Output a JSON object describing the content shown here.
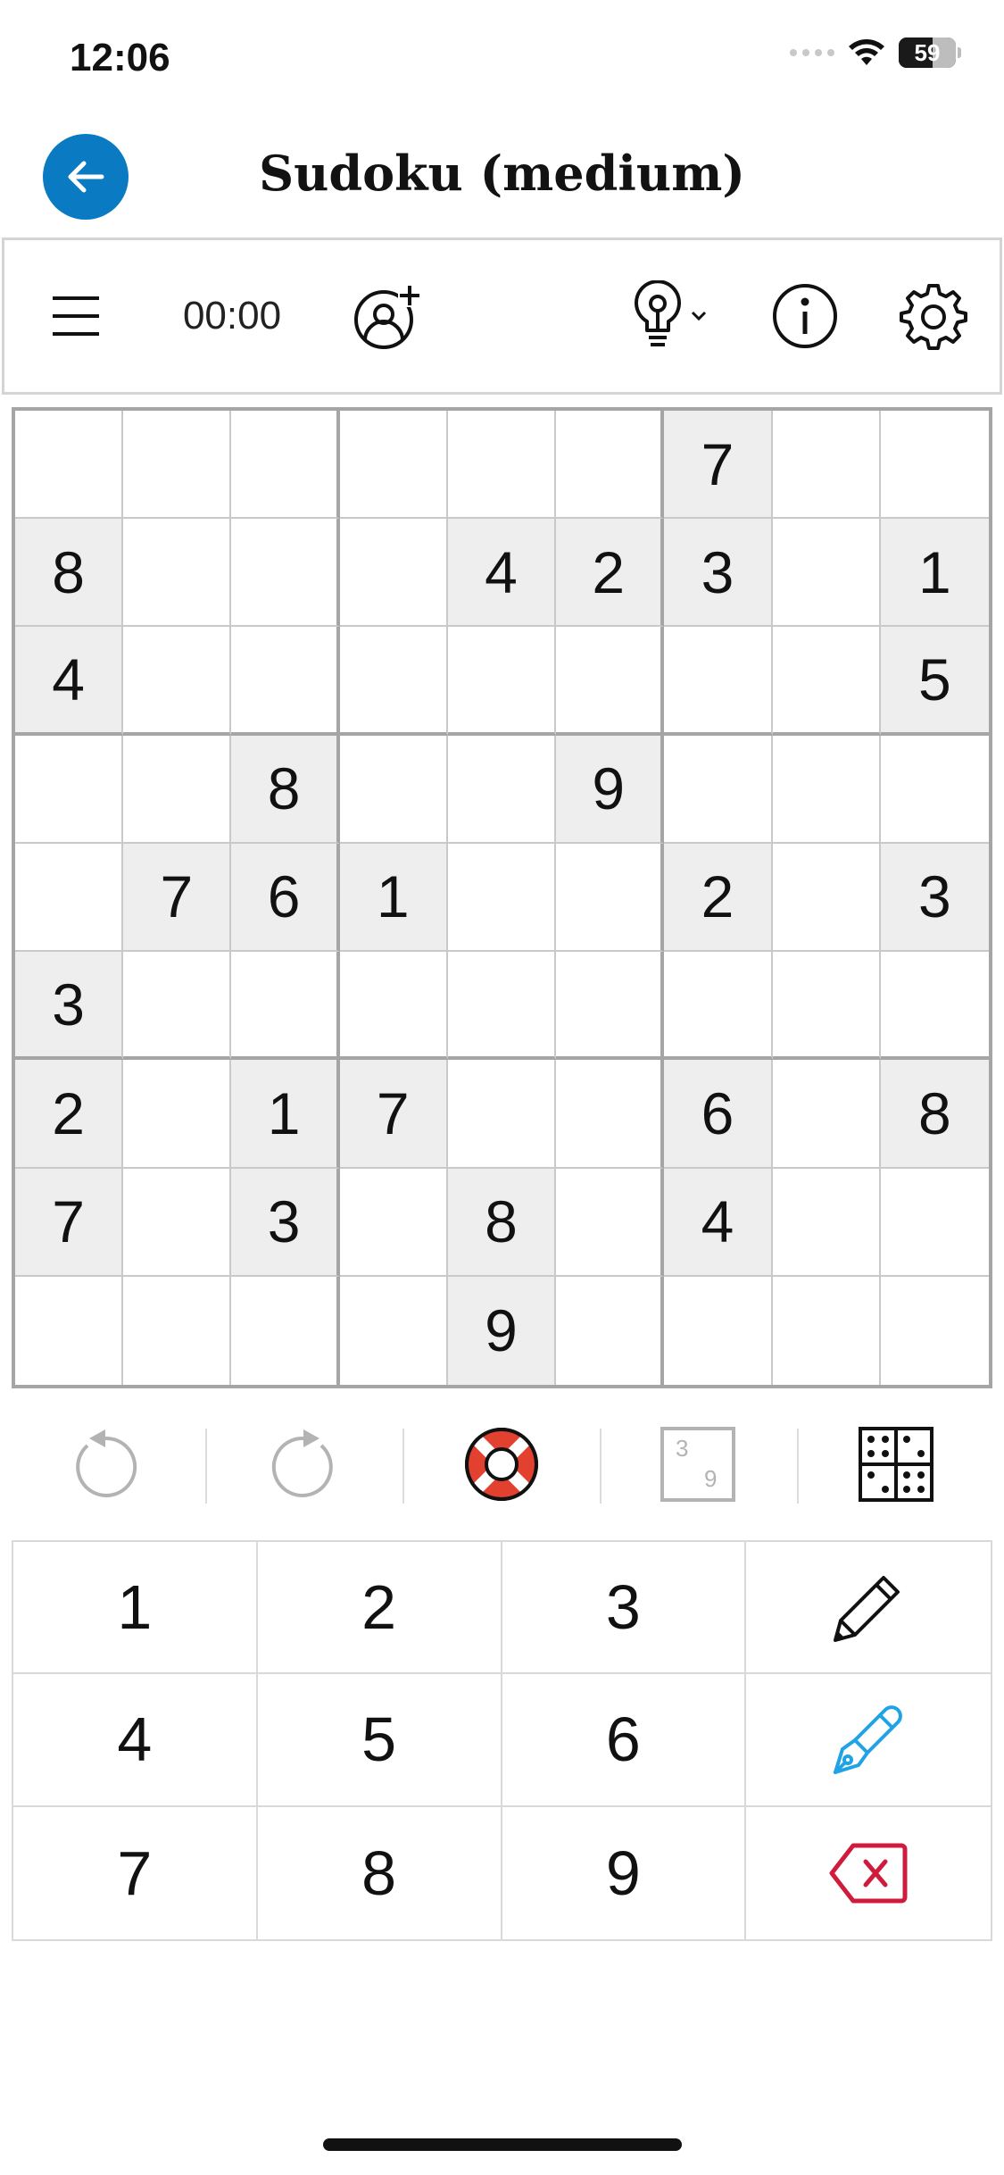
{
  "status_bar": {
    "time": "12:06",
    "battery_label": "59",
    "battery_level": 0.59,
    "icons": [
      "signal-icon",
      "wifi-icon",
      "battery-icon"
    ]
  },
  "header": {
    "title": "Sudoku (medium)",
    "back_icon": "arrow-left-icon",
    "accent_color": "#0a7bc2"
  },
  "toolbar": {
    "timer": "00:00",
    "icons": [
      "menu-icon",
      "add-user-icon",
      "hint-bulb-icon",
      "chevron-down-icon",
      "info-icon",
      "gear-icon"
    ]
  },
  "grid": {
    "rows": [
      [
        "",
        "",
        "",
        "",
        "",
        "",
        "7",
        "",
        ""
      ],
      [
        "8",
        "",
        "",
        "",
        "4",
        "2",
        "3",
        "",
        "1"
      ],
      [
        "4",
        "",
        "",
        "",
        "",
        "",
        "",
        "",
        "5"
      ],
      [
        "",
        "",
        "8",
        "",
        "",
        "9",
        "",
        "",
        ""
      ],
      [
        "",
        "7",
        "6",
        "1",
        "",
        "",
        "2",
        "",
        "3"
      ],
      [
        "3",
        "",
        "",
        "",
        "",
        "",
        "",
        "",
        ""
      ],
      [
        "2",
        "",
        "1",
        "7",
        "",
        "",
        "6",
        "",
        "8"
      ],
      [
        "7",
        "",
        "3",
        "",
        "8",
        "",
        "4",
        "",
        ""
      ],
      [
        "",
        "",
        "",
        "",
        "9",
        "",
        "",
        "",
        ""
      ]
    ]
  },
  "actions": {
    "icons": [
      "undo-icon",
      "redo-icon",
      "lifebuoy-icon",
      "candidates-icon",
      "grid-view-icon"
    ],
    "candidate_digits": [
      "3",
      "9"
    ],
    "lifebuoy_color": "#e2412f"
  },
  "keypad": {
    "keys": [
      "1",
      "2",
      "3",
      "4",
      "5",
      "6",
      "7",
      "8",
      "9"
    ],
    "tools": [
      "pencil-icon",
      "pen-icon",
      "delete-icon"
    ],
    "pen_color": "#1fa3e6",
    "delete_color": "#d01c3c"
  }
}
